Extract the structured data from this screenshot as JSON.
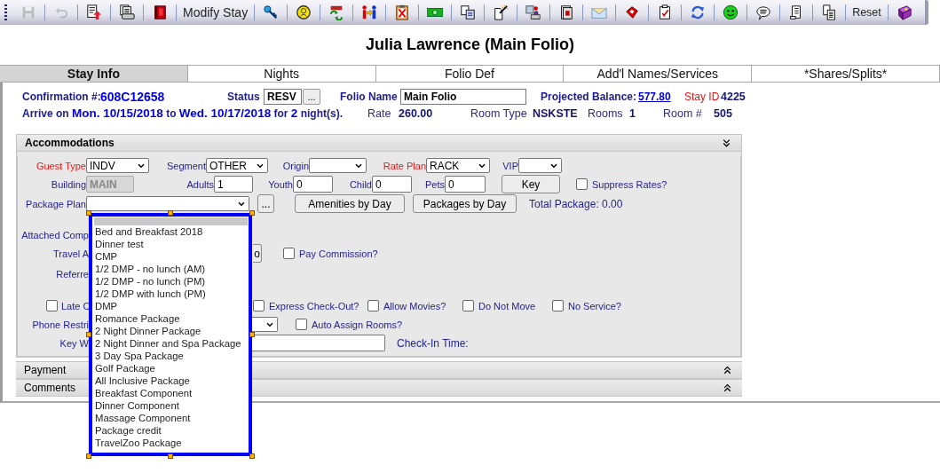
{
  "toolbar": [
    {
      "kind": "icon",
      "disabled": true
    },
    {
      "kind": "icon",
      "disabled": true
    },
    {
      "kind": "icon",
      "disabled": false
    },
    {
      "kind": "icon",
      "disabled": false
    },
    {
      "kind": "icon",
      "disabled": false
    },
    {
      "kind": "text",
      "label": "Modify Stay",
      "disabled": false
    },
    {
      "kind": "icon",
      "disabled": false
    },
    {
      "kind": "icon",
      "disabled": false
    },
    {
      "kind": "icon",
      "disabled": false
    },
    {
      "kind": "icon",
      "disabled": false
    },
    {
      "kind": "icon",
      "disabled": false
    },
    {
      "kind": "icon",
      "disabled": false
    },
    {
      "kind": "icon",
      "disabled": false
    },
    {
      "kind": "icon",
      "disabled": false
    },
    {
      "kind": "icon",
      "disabled": false
    },
    {
      "kind": "icon",
      "disabled": false
    },
    {
      "kind": "icon",
      "disabled": false
    },
    {
      "kind": "icon",
      "disabled": false
    },
    {
      "kind": "icon",
      "disabled": false
    },
    {
      "kind": "icon",
      "disabled": false
    },
    {
      "kind": "icon",
      "disabled": false
    },
    {
      "kind": "icon",
      "disabled": false
    },
    {
      "kind": "icon",
      "disabled": false
    },
    {
      "kind": "icon",
      "disabled": false
    },
    {
      "kind": "text",
      "label": "Reset",
      "disabled": false
    },
    {
      "kind": "icon",
      "disabled": false
    }
  ],
  "title": "Julia Lawrence (Main Folio)",
  "tabs": [
    {
      "label": "Stay Info",
      "selected": true
    },
    {
      "label": "Nights",
      "selected": false
    },
    {
      "label": "Folio Def",
      "selected": false
    },
    {
      "label": "Add'l Names/Services",
      "selected": false
    },
    {
      "label": "*Shares/Splits*",
      "selected": false
    }
  ],
  "stay": {
    "confirmation_label": "Confirmation #:",
    "confirmation": "608C12658",
    "status_label": "Status",
    "status": "RESV",
    "status_button": "...",
    "folio_name_label": "Folio Name",
    "folio_name": "Main Folio",
    "balance_label": "Projected Balance:",
    "balance": "577.80",
    "stay_id_label": "Stay ID",
    "stay_id": "4225",
    "arrival": "Arrive on **Mon. 10/15/2018** to **Wed. 10/17/2018** for **2** night(s).",
    "rate_label": "Rate",
    "rate": "260.00",
    "room_type_label": "Room Type",
    "room_type": "NSKSTE",
    "rooms_label": "Rooms",
    "rooms": "1",
    "room_number_label": "Room #",
    "room_number": "505"
  },
  "accommodations": {
    "title": "Accommodations",
    "expanded": true,
    "lines": [
      {
        "fields": [
          {
            "kind": "select",
            "label": "Guest Type",
            "value": "INDV",
            "required": true
          },
          {
            "kind": "select",
            "label": "Segment",
            "value": "OTHER",
            "required": false
          },
          {
            "kind": "select",
            "label": "Origin",
            "required": false
          },
          {
            "kind": "select",
            "label": "Rate Plan",
            "value": "RACK",
            "required": true
          },
          {
            "kind": "select",
            "label": "VIP",
            "required": false
          }
        ]
      },
      {
        "fields": [
          {
            "kind": "input",
            "label": "Building",
            "value": "MAIN",
            "disabled": true
          },
          {
            "kind": "input",
            "label": "Adults",
            "value": "1",
            "disabled": false
          },
          {
            "kind": "input",
            "label": "Youth",
            "value": "0",
            "disabled": false
          },
          {
            "kind": "input",
            "label": "Child",
            "value": "0",
            "disabled": false
          },
          {
            "kind": "input",
            "label": "Pets",
            "value": "0",
            "disabled": false
          },
          {
            "kind": "button",
            "label": "Key"
          },
          {
            "kind": "checkbox",
            "label": "Suppress Rates?",
            "checked": false
          }
        ]
      },
      {
        "fields": [
          {
            "kind": "select",
            "label": "Package Plan",
            "required": false
          },
          {
            "kind": "button",
            "label": "..."
          },
          {
            "kind": "button",
            "label": "Amenities by Day"
          },
          {
            "kind": "button",
            "label": "Packages by Day"
          },
          {
            "kind": "text",
            "label": "Total Package: 0.00"
          }
        ]
      },
      {
        "fields": [
          {
            "kind": "text",
            "label": "Attached Comp"
          }
        ]
      },
      {
        "fields": [
          {
            "kind": "text",
            "label": "Travel A"
          },
          {
            "kind": "button",
            "label": "o"
          },
          {
            "kind": "checkbox",
            "label": "Pay Commission?",
            "checked": false
          }
        ]
      },
      {
        "fields": [
          {
            "kind": "text",
            "label": "Referre"
          }
        ]
      },
      {
        "fields": [
          {
            "kind": "checkbox",
            "label": "Late C",
            "checked": false
          },
          {
            "kind": "checkbox",
            "label": "Express Check-Out?",
            "checked": false
          },
          {
            "kind": "checkbox",
            "label": "Allow Movies?",
            "checked": false
          },
          {
            "kind": "checkbox",
            "label": "Do Not Move",
            "checked": false
          },
          {
            "kind": "checkbox",
            "label": "No Service?",
            "checked": false
          }
        ]
      },
      {
        "fields": [
          {
            "kind": "text",
            "label": "Phone Restri"
          },
          {
            "kind": "select"
          },
          {
            "kind": "checkbox",
            "label": "Auto Assign Rooms?",
            "checked": false
          }
        ]
      },
      {
        "fields": [
          {
            "kind": "text",
            "label": "Key W"
          },
          {
            "kind": "input",
            "disabled": false
          },
          {
            "kind": "text",
            "label": "Check-In Time:"
          }
        ]
      }
    ]
  },
  "package_dropdown": {
    "blank_selected": true,
    "options": [
      {
        "label": "Bed and Breakfast 2018",
        "selected": false
      },
      {
        "label": "Dinner test",
        "selected": false
      },
      {
        "label": "CMP",
        "selected": false
      },
      {
        "label": "1/2 DMP - no lunch (AM)",
        "selected": false
      },
      {
        "label": "1/2 DMP - no lunch (PM)",
        "selected": false
      },
      {
        "label": "1/2 DMP with lunch (PM)",
        "selected": false
      },
      {
        "label": "DMP",
        "selected": false
      },
      {
        "label": "Romance Package",
        "selected": false
      },
      {
        "label": "2 Night Dinner Package",
        "selected": false
      },
      {
        "label": "2 Night Dinner and Spa Package",
        "selected": false
      },
      {
        "label": "3 Day Spa Package",
        "selected": false
      },
      {
        "label": "Golf Package",
        "selected": false
      },
      {
        "label": "All Inclusive Package",
        "selected": false
      },
      {
        "label": "Breakfast Component",
        "selected": false
      },
      {
        "label": "Dinner Component",
        "selected": false
      },
      {
        "label": "Massage Component",
        "selected": false
      },
      {
        "label": "Package credit",
        "selected": false
      },
      {
        "label": "TravelZoo Package",
        "selected": false
      }
    ]
  },
  "sections": [
    {
      "title": "Payment",
      "expanded": false
    },
    {
      "title": "Comments",
      "expanded": false
    }
  ]
}
